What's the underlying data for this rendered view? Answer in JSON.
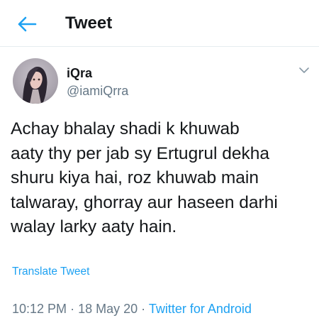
{
  "header": {
    "title": "Tweet",
    "back_icon": "arrow-left-icon"
  },
  "colors": {
    "accent": "#1da1f2",
    "text": "#14171a",
    "secondary": "#657786",
    "divider": "#e6ecf0"
  },
  "tweet": {
    "author": {
      "name": "iQra",
      "handle": "@iamiQrra",
      "avatar": "avatar-image"
    },
    "menu_icon": "chevron-down-icon",
    "text": "Achay bhalay shadi k khuwab\naaty thy per jab sy Ertugrul dekha\nshuru kiya hai, roz khuwab main\ntalwaray, ghorray aur haseen darhi\nwalay larky aaty hain.",
    "translate_label": "Translate Tweet",
    "time": "10:12 PM",
    "separator": "·",
    "date": "18 May 20",
    "source": "Twitter for Android"
  }
}
